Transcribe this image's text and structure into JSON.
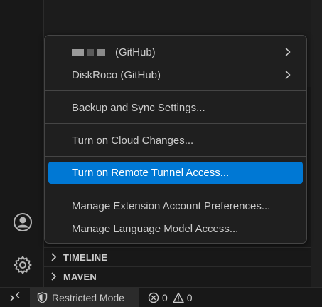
{
  "menu": {
    "accounts": [
      {
        "label": "(GitHub)",
        "redacted": true
      },
      {
        "label": "DiskRoco (GitHub)",
        "redacted": false
      }
    ],
    "items": [
      {
        "label": "Backup and Sync Settings..."
      },
      {
        "label": "Turn on Cloud Changes..."
      },
      {
        "label": "Turn on Remote Tunnel Access...",
        "active": true
      },
      {
        "label": "Manage Extension Account Preferences..."
      },
      {
        "label": "Manage Language Model Access..."
      }
    ]
  },
  "sections": {
    "timeline": "TIMELINE",
    "maven": "MAVEN"
  },
  "status_bar": {
    "restricted_mode": "Restricted Mode",
    "errors": "0",
    "warnings": "0"
  },
  "icons": {
    "accounts": "account-icon",
    "manage": "gear-icon",
    "remote": "remote-icon",
    "shield": "shield-icon",
    "error": "error-icon",
    "warning": "warning-icon"
  },
  "colors": {
    "accent": "#0078d4",
    "background": "#181818",
    "menu_background": "#1f1f1f",
    "menu_border": "#454545"
  }
}
